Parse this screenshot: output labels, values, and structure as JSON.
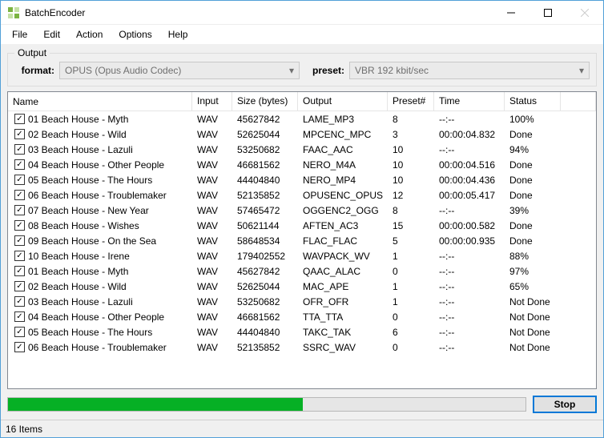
{
  "window": {
    "title": "BatchEncoder"
  },
  "menu": {
    "items": [
      "File",
      "Edit",
      "Action",
      "Options",
      "Help"
    ]
  },
  "output_group": {
    "legend": "Output",
    "format_label": "format:",
    "format_value": "OPUS (Opus Audio Codec)",
    "preset_label": "preset:",
    "preset_value": "VBR 192 kbit/sec"
  },
  "columns": {
    "name": "Name",
    "input": "Input",
    "size": "Size (bytes)",
    "output": "Output",
    "preset": "Preset#",
    "time": "Time",
    "status": "Status"
  },
  "rows": [
    {
      "checked": true,
      "name": "01 Beach House - Myth",
      "input": "WAV",
      "size": "45627842",
      "output": "LAME_MP3",
      "preset": "8",
      "time": "--:--",
      "status": "100%"
    },
    {
      "checked": true,
      "name": "02 Beach House - Wild",
      "input": "WAV",
      "size": "52625044",
      "output": "MPCENC_MPC",
      "preset": "3",
      "time": "00:00:04.832",
      "status": "Done"
    },
    {
      "checked": true,
      "name": "03 Beach House - Lazuli",
      "input": "WAV",
      "size": "53250682",
      "output": "FAAC_AAC",
      "preset": "10",
      "time": "--:--",
      "status": "94%"
    },
    {
      "checked": true,
      "name": "04 Beach House - Other People",
      "input": "WAV",
      "size": "46681562",
      "output": "NERO_M4A",
      "preset": "10",
      "time": "00:00:04.516",
      "status": "Done"
    },
    {
      "checked": true,
      "name": "05 Beach House - The Hours",
      "input": "WAV",
      "size": "44404840",
      "output": "NERO_MP4",
      "preset": "10",
      "time": "00:00:04.436",
      "status": "Done"
    },
    {
      "checked": true,
      "name": "06 Beach House - Troublemaker",
      "input": "WAV",
      "size": "52135852",
      "output": "OPUSENC_OPUS",
      "preset": "12",
      "time": "00:00:05.417",
      "status": "Done"
    },
    {
      "checked": true,
      "name": "07 Beach House - New Year",
      "input": "WAV",
      "size": "57465472",
      "output": "OGGENC2_OGG",
      "preset": "8",
      "time": "--:--",
      "status": "39%"
    },
    {
      "checked": true,
      "name": "08 Beach House - Wishes",
      "input": "WAV",
      "size": "50621144",
      "output": "AFTEN_AC3",
      "preset": "15",
      "time": "00:00:00.582",
      "status": "Done"
    },
    {
      "checked": true,
      "name": "09 Beach House - On the Sea",
      "input": "WAV",
      "size": "58648534",
      "output": "FLAC_FLAC",
      "preset": "5",
      "time": "00:00:00.935",
      "status": "Done"
    },
    {
      "checked": true,
      "name": "10 Beach House - Irene",
      "input": "WAV",
      "size": "179402552",
      "output": "WAVPACK_WV",
      "preset": "1",
      "time": "--:--",
      "status": "88%"
    },
    {
      "checked": true,
      "name": "01 Beach House - Myth",
      "input": "WAV",
      "size": "45627842",
      "output": "QAAC_ALAC",
      "preset": "0",
      "time": "--:--",
      "status": "97%"
    },
    {
      "checked": true,
      "name": "02 Beach House - Wild",
      "input": "WAV",
      "size": "52625044",
      "output": "MAC_APE",
      "preset": "1",
      "time": "--:--",
      "status": "65%"
    },
    {
      "checked": true,
      "name": "03 Beach House - Lazuli",
      "input": "WAV",
      "size": "53250682",
      "output": "OFR_OFR",
      "preset": "1",
      "time": "--:--",
      "status": "Not Done"
    },
    {
      "checked": true,
      "name": "04 Beach House - Other People",
      "input": "WAV",
      "size": "46681562",
      "output": "TTA_TTA",
      "preset": "0",
      "time": "--:--",
      "status": "Not Done"
    },
    {
      "checked": true,
      "name": "05 Beach House - The Hours",
      "input": "WAV",
      "size": "44404840",
      "output": "TAKC_TAK",
      "preset": "6",
      "time": "--:--",
      "status": "Not Done"
    },
    {
      "checked": true,
      "name": "06 Beach House - Troublemaker",
      "input": "WAV",
      "size": "52135852",
      "output": "SSRC_WAV",
      "preset": "0",
      "time": "--:--",
      "status": "Not Done"
    }
  ],
  "progress": {
    "percent": 57
  },
  "buttons": {
    "stop": "Stop"
  },
  "statusbar": {
    "text": "16 Items"
  }
}
